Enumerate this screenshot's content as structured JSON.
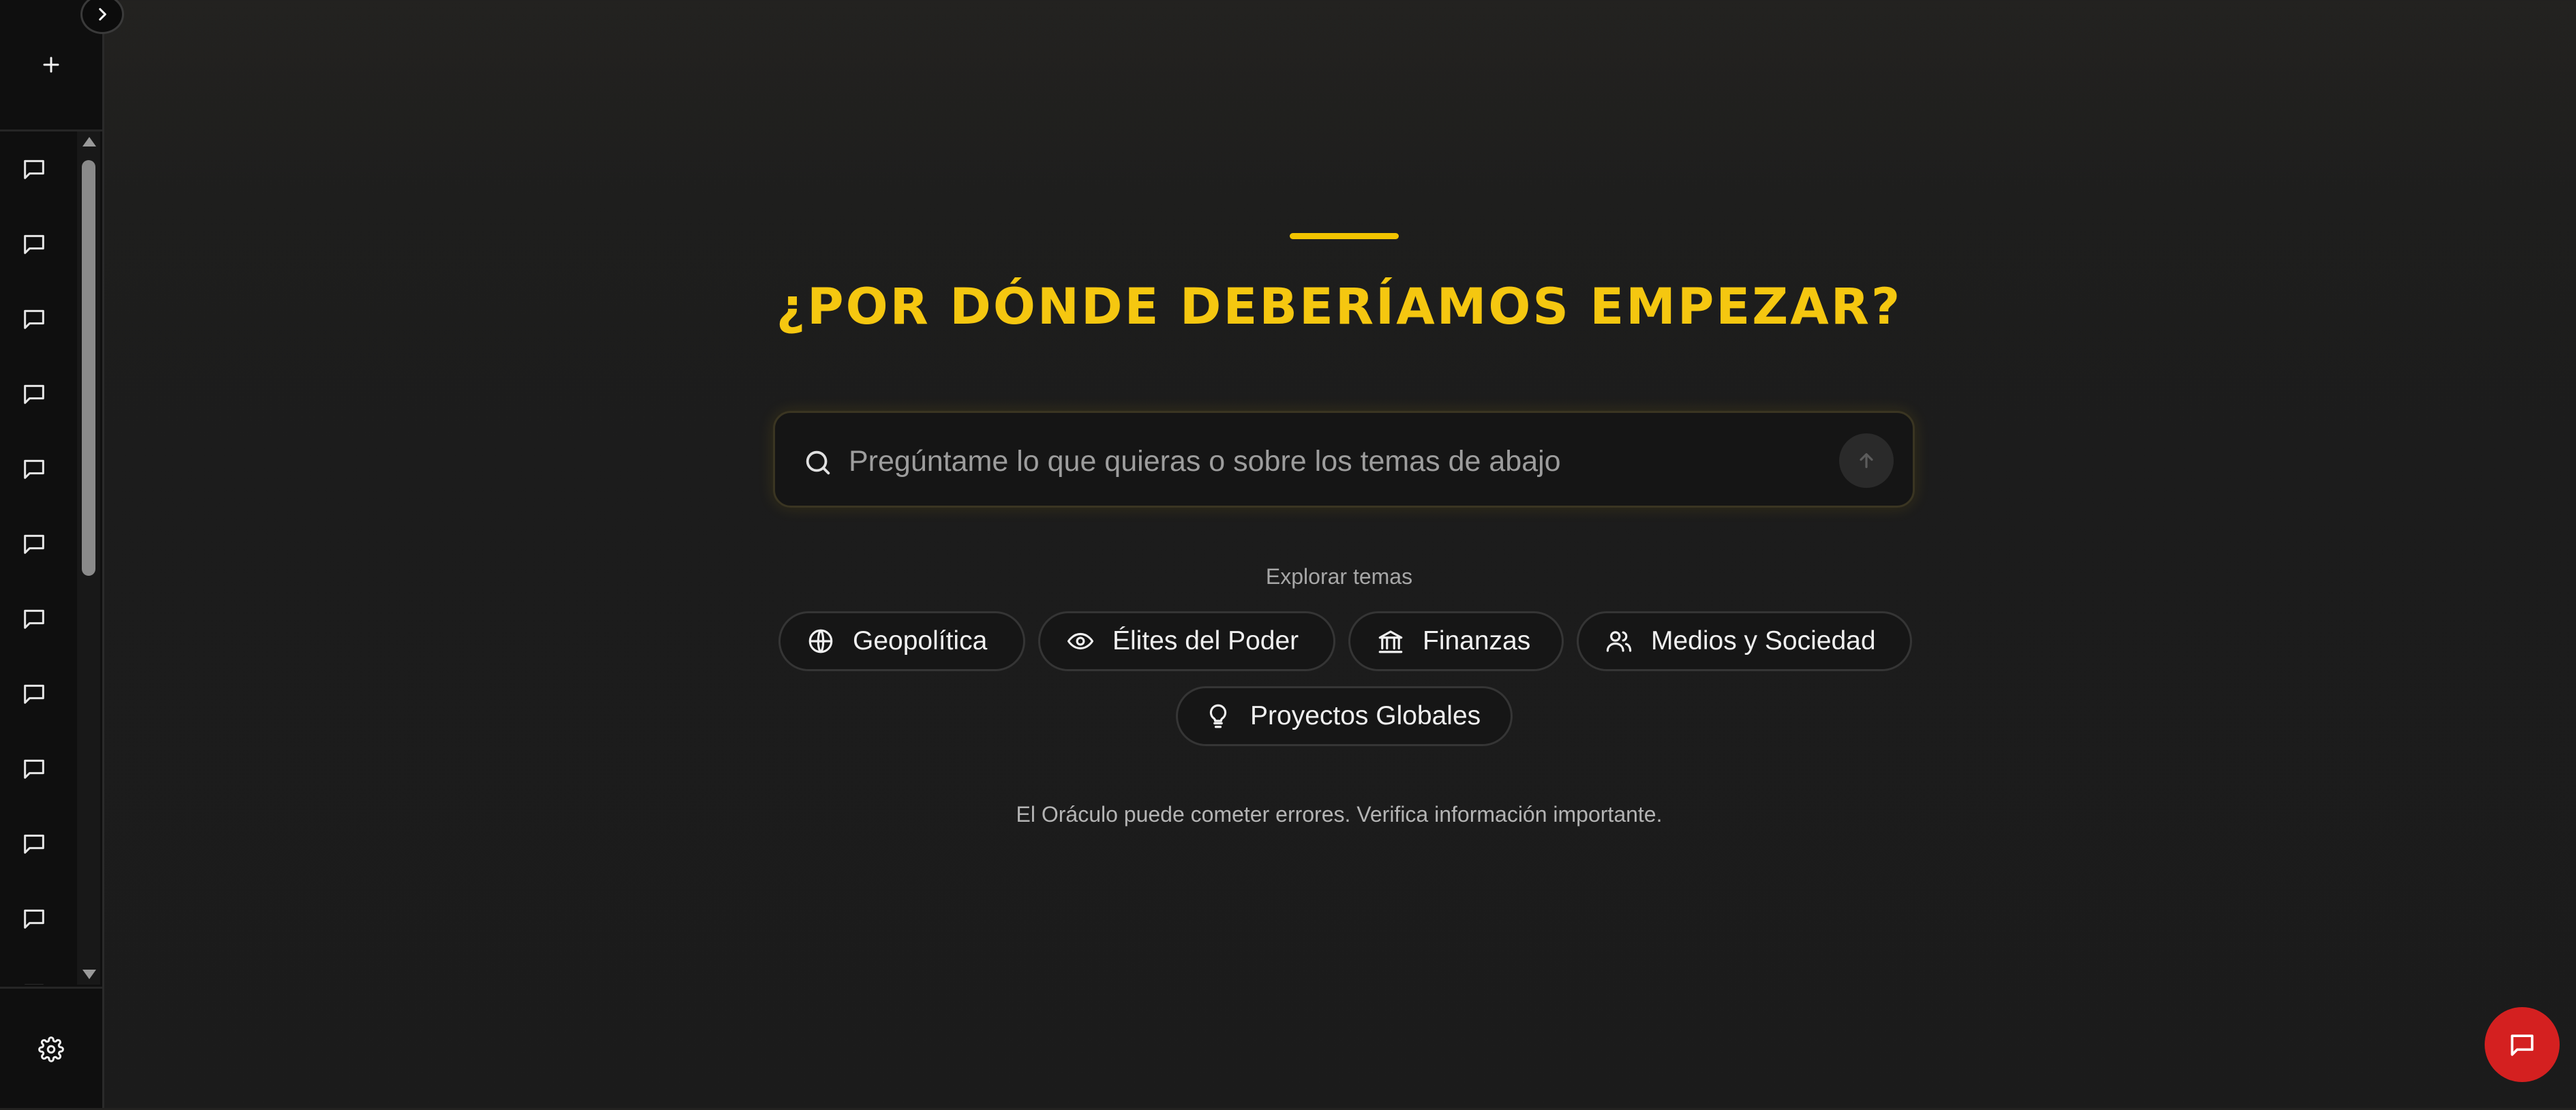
{
  "sidebar": {
    "toggle_icon": "chevron-right-icon",
    "new_chat_icon": "plus-icon",
    "history_icon": "chat-bubble-icon",
    "history_count": 12,
    "settings_icon": "gear-icon"
  },
  "main": {
    "title": "¿POR DÓNDE DEBERÍAMOS EMPEZAR?",
    "search": {
      "placeholder": "Pregúntame lo que quieras o sobre los temas de abajo",
      "value": ""
    },
    "explore_label": "Explorar temas",
    "topics": [
      {
        "label": "Geopolítica",
        "icon": "globe-icon"
      },
      {
        "label": "Élites del Poder",
        "icon": "eye-icon"
      },
      {
        "label": "Finanzas",
        "icon": "bank-icon"
      },
      {
        "label": "Medios y Sociedad",
        "icon": "users-icon"
      },
      {
        "label": "Proyectos Globales",
        "icon": "lightbulb-icon"
      }
    ],
    "disclaimer": "El Oráculo puede cometer errores. Verifica información importante."
  },
  "colors": {
    "accent": "#f5c710",
    "fab": "#d42020",
    "background": "#1b1b1b",
    "sidebar": "#0f0f0f"
  }
}
